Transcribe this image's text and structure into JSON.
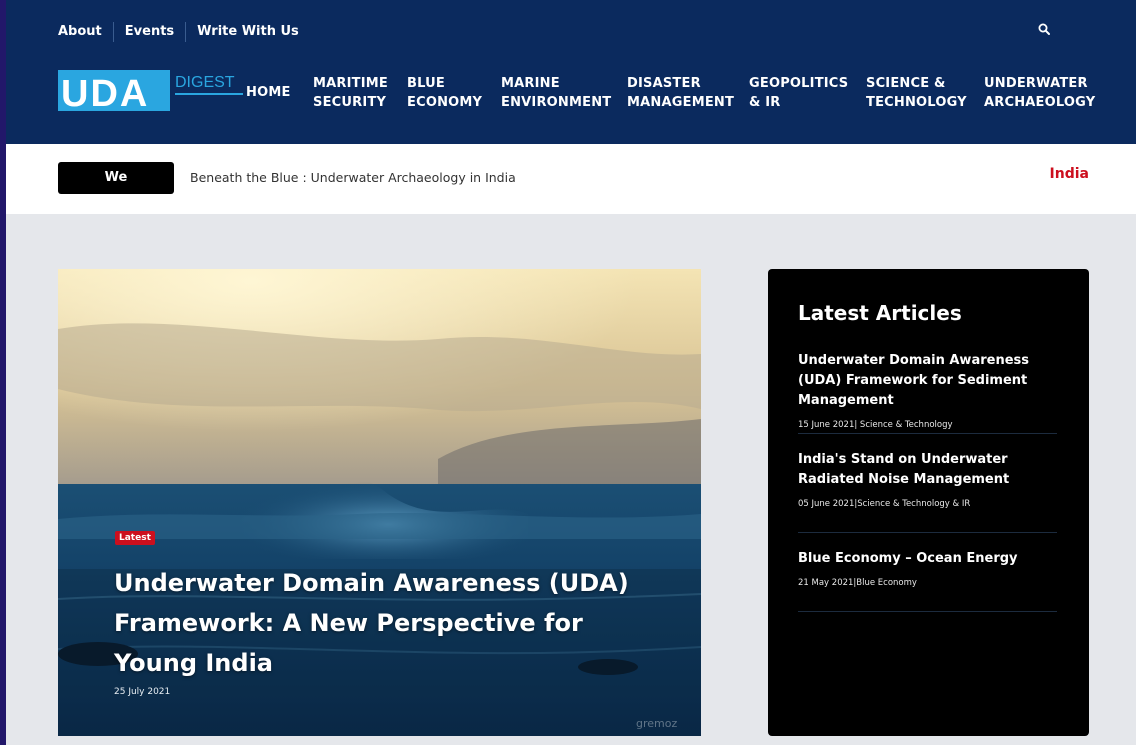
{
  "header": {
    "top_links": [
      "About",
      "Events",
      "Write With Us"
    ],
    "logo": {
      "main": "UDA",
      "sub": "DIGEST"
    },
    "nav": [
      "HOME",
      "MARITIME\nSECURITY",
      "BLUE\nECONOMY",
      "MARINE\nENVIRONMENT",
      "DISASTER\nMANAGEMENT",
      "GEOPOLITICS\n& IR",
      "SCIENCE &\nTECHNOLOGY",
      "UNDERWATER\nARCHAEOLOGY"
    ]
  },
  "recommend": {
    "label": "We Recommend",
    "text": "Beneath the Blue : Underwater Archaeology in India",
    "tag": "India"
  },
  "hero": {
    "badge": "Latest",
    "title": "Underwater Domain Awareness (UDA) Framework: A New Perspective for Young India",
    "date": "25 July 2021",
    "watermark": "gremoz"
  },
  "sidebar": {
    "title": "Latest Articles",
    "articles": [
      {
        "title": "Underwater Domain Awareness (UDA) Framework for Sediment Management",
        "meta": "15 June 2021| Science & Technology"
      },
      {
        "title": "India's Stand on Underwater Radiated Noise Management",
        "meta": "05 June 2021|Science & Technology & IR"
      },
      {
        "title": "Blue Economy – Ocean Energy",
        "meta": "21 May 2021|Blue Economy"
      }
    ]
  },
  "colors": {
    "header_bg": "#0b2a5e",
    "accent_red": "#cc0f1e",
    "logo_blue": "#2aa6e0"
  },
  "icons": {
    "search": "search-icon"
  }
}
